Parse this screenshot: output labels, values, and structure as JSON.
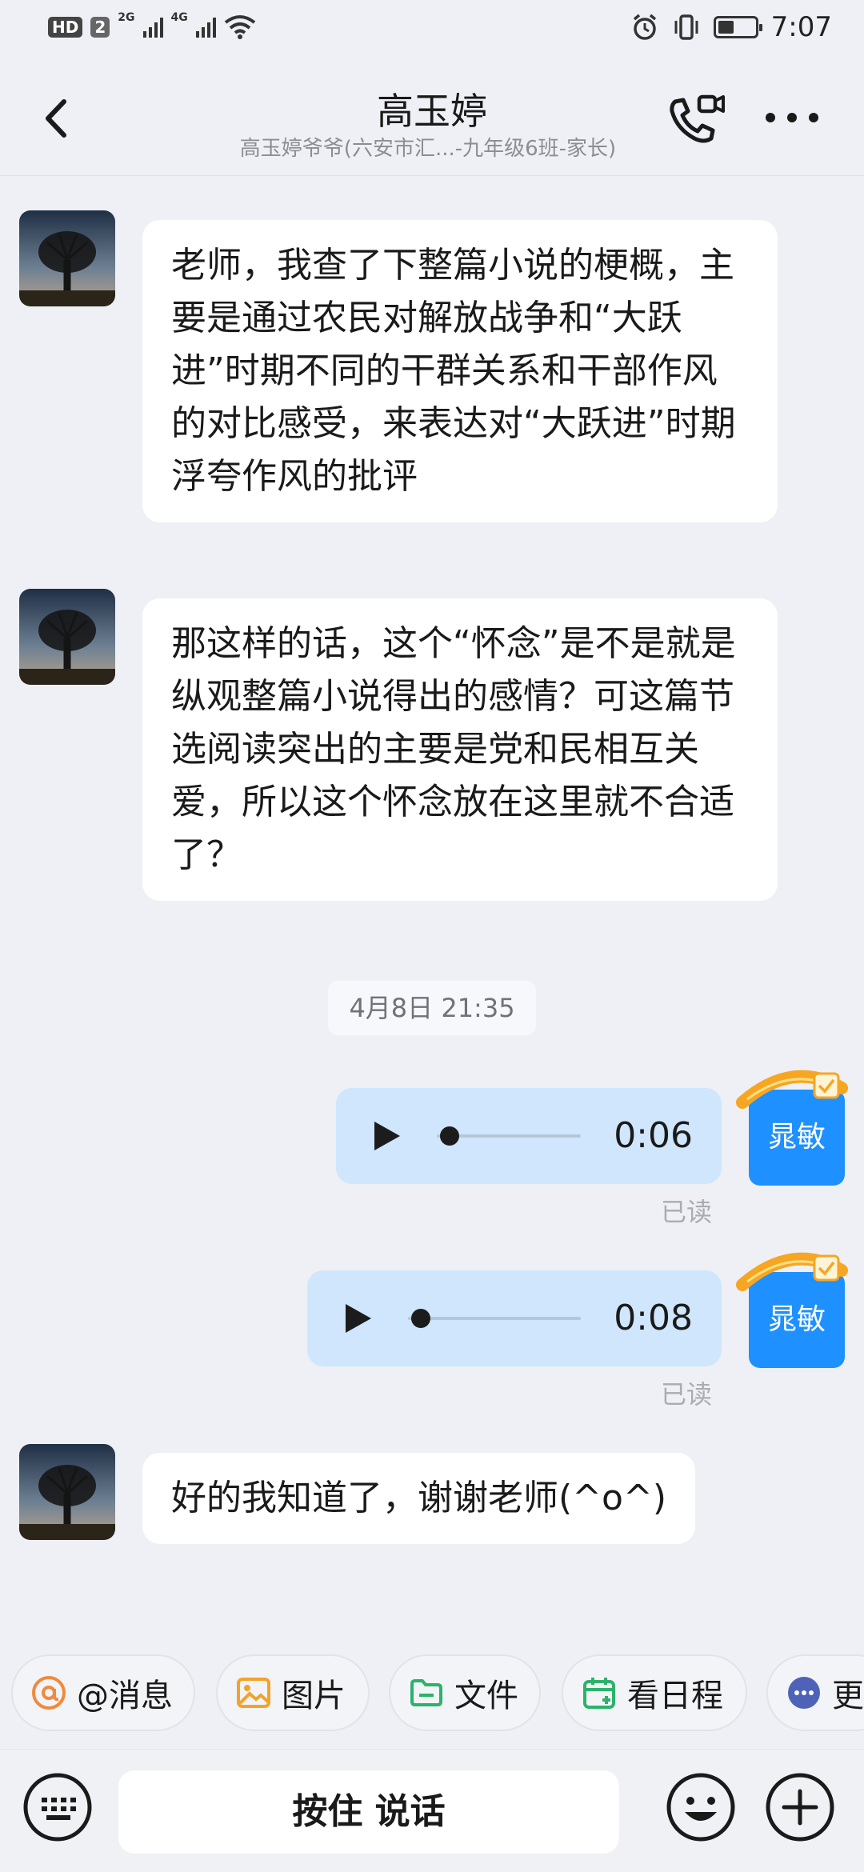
{
  "status_bar": {
    "hd": "HD",
    "sim": "2",
    "net1": "2G",
    "net2": "4G",
    "time": "7:07",
    "battery_level": 0.45
  },
  "header": {
    "title": "高玉婷",
    "subtitle": "高玉婷爷爷(六安市汇...-九年级6班-家长)"
  },
  "messages": [
    {
      "type": "text",
      "side": "in",
      "text": "老师，我查了下整篇小说的梗概，主要是通过农民对解放战争和“大跃进”时期不同的干群关系和干部作风的对比感受，来表达对“大跃进”时期浮夸作风的批评"
    },
    {
      "type": "text",
      "side": "in",
      "text": "那这样的话，这个“怀念”是不是就是纵观整篇小说得出的感情？可这篇节选阅读突出的主要是党和民相互关爱，所以这个怀念放在这里就不合适了？"
    },
    {
      "type": "time",
      "text": "4月8日 21:35"
    },
    {
      "type": "voice",
      "side": "out",
      "duration": "0:06",
      "read": "已读",
      "sender": "晁敏"
    },
    {
      "type": "voice",
      "side": "out",
      "duration": "0:08",
      "read": "已读",
      "sender": "晁敏"
    },
    {
      "type": "text",
      "side": "in",
      "text": "好的我知道了，谢谢老师(^o^)"
    }
  ],
  "quick_actions": [
    {
      "label": "@消息",
      "icon": "at-icon"
    },
    {
      "label": "图片",
      "icon": "image-icon"
    },
    {
      "label": "文件",
      "icon": "folder-icon"
    },
    {
      "label": "看日程",
      "icon": "calendar-icon"
    },
    {
      "label": "更",
      "icon": "more-dots-icon"
    }
  ],
  "input_bar": {
    "talk_label": "按住 说话"
  },
  "colors": {
    "accent": "#1e90ff",
    "voice_bubble": "#cfe6fd",
    "background": "#eef0f5"
  }
}
